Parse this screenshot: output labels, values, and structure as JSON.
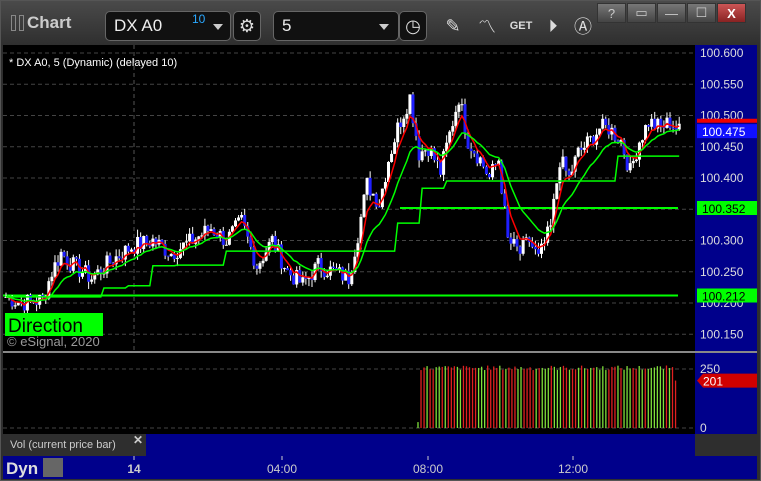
{
  "window": {
    "title": "Chart",
    "buttons": [
      "?",
      "▭",
      "—",
      "☐",
      "X"
    ]
  },
  "toolbar": {
    "symbol": "DX A0",
    "symbol_badge": "10",
    "interval": "5"
  },
  "chart": {
    "legend": "* DX A0, 5 (Dynamic) (delayed 10)",
    "copyright": "© eSignal, 2020",
    "direction_label": "Direction",
    "price_ticks": [
      "100.600",
      "100.550",
      "100.500",
      "100.450",
      "100.400",
      "100.350",
      "100.300",
      "100.250",
      "100.200",
      "100.150"
    ],
    "price_tick_values": [
      100.6,
      100.55,
      100.5,
      100.45,
      100.4,
      100.35,
      100.3,
      100.25,
      100.2,
      100.15
    ],
    "last_price": "100.475",
    "level_upper": "100.352",
    "level_lower": "100.212",
    "colors": {
      "up": "#ffffff",
      "down": "#1f1fff",
      "fast_ma": "#ff0000",
      "slow_ma": "#00ff00",
      "axis_bg": "#00008b"
    }
  },
  "chart_data": {
    "type": "candlestick",
    "keypoints_bar_index": [
      0,
      5,
      12,
      15,
      18,
      22,
      28,
      35,
      41,
      48,
      54,
      61,
      67,
      72,
      77,
      82,
      87,
      92,
      97,
      102,
      107,
      112,
      115,
      118,
      122,
      125,
      128,
      132,
      135,
      138,
      142,
      145,
      148,
      151,
      155,
      158,
      161,
      164,
      168,
      171,
      174,
      178,
      181,
      184,
      187,
      191,
      194,
      197,
      201,
      204,
      207,
      210,
      214,
      217,
      220
    ],
    "keypoints_price": [
      100.21,
      100.2,
      100.205,
      100.25,
      100.28,
      100.26,
      100.24,
      100.27,
      100.29,
      100.3,
      100.28,
      100.3,
      100.32,
      100.3,
      100.33,
      100.26,
      100.3,
      100.25,
      100.23,
      100.26,
      100.25,
      100.24,
      100.31,
      100.39,
      100.36,
      100.43,
      100.48,
      100.53,
      100.44,
      100.45,
      100.41,
      100.47,
      100.53,
      100.46,
      100.43,
      100.4,
      100.43,
      100.3,
      100.28,
      100.3,
      100.27,
      100.32,
      100.43,
      100.4,
      100.44,
      100.46,
      100.48,
      100.48,
      100.46,
      100.41,
      100.46,
      100.49,
      100.48,
      100.49,
      100.475
    ],
    "levels": [
      100.352,
      100.212
    ]
  },
  "volume": {
    "label": "Vol (current price bar)",
    "ticks": [
      "250",
      "0"
    ],
    "last": "201",
    "bar_count": 86,
    "typical": 255
  },
  "xaxis": {
    "mode": "Dyn",
    "ticks": [
      "14",
      "04:00",
      "08:00",
      "12:00"
    ]
  }
}
